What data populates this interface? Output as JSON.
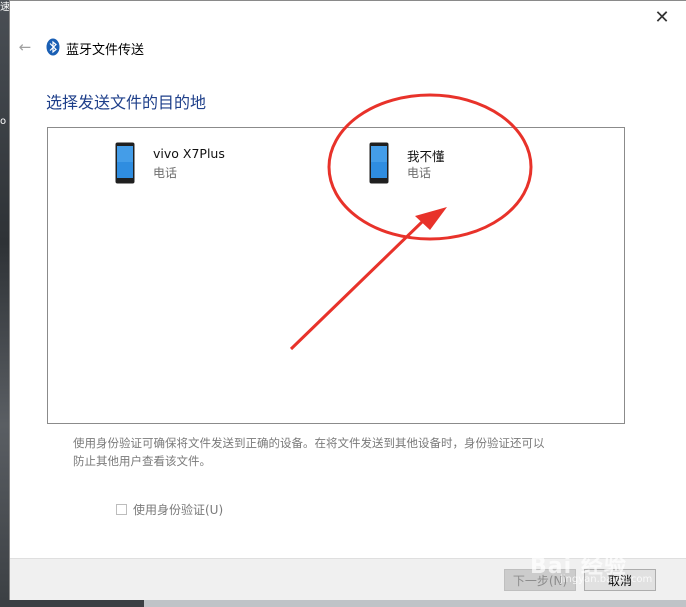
{
  "desktop": {
    "frag1": "速",
    "frag2": "o"
  },
  "window": {
    "title": "蓝牙文件传送",
    "close_icon": "close-icon",
    "back_icon": "back-arrow-icon",
    "bluetooth_icon": "bluetooth-icon"
  },
  "main": {
    "heading": "选择发送文件的目的地",
    "devices": [
      {
        "name": "vivo X7Plus",
        "type": "电话",
        "icon": "phone-icon"
      },
      {
        "name": "我不懂",
        "type": "电话",
        "icon": "phone-icon"
      }
    ],
    "description_line1": "使用身份验证可确保将文件发送到正确的设备。在将文件发送到其他设备时，身份验证还可以",
    "description_line2": "防止其他用户查看该文件。",
    "auth_checkbox_label": "使用身份验证(U)",
    "auth_checked": false
  },
  "footer": {
    "next_label": "下一步(N)",
    "cancel_label": "取消"
  },
  "colors": {
    "heading": "#1e3f8a",
    "annotation": "#e8322a",
    "bluetooth": "#1a5fb4"
  }
}
